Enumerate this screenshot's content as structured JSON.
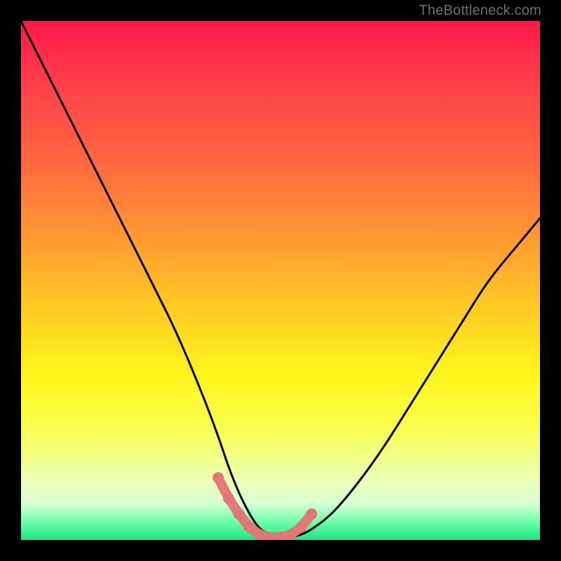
{
  "watermark": "TheBottleneck.com",
  "chart_data": {
    "type": "line",
    "title": "",
    "xlabel": "",
    "ylabel": "",
    "xlim": [
      0,
      100
    ],
    "ylim": [
      0,
      100
    ],
    "grid": false,
    "legend": false,
    "series": [
      {
        "name": "black-curve",
        "color": "#000000",
        "x": [
          0,
          5,
          10,
          15,
          20,
          25,
          30,
          35,
          38,
          40,
          42,
          44,
          46,
          48,
          50,
          52,
          54,
          56,
          60,
          65,
          70,
          75,
          80,
          85,
          90,
          95,
          100
        ],
        "y": [
          100,
          90,
          80,
          70,
          60,
          50,
          40,
          28,
          20,
          14,
          9,
          5,
          2,
          1,
          0.5,
          0.5,
          1,
          2,
          5,
          11,
          18,
          26,
          34,
          42,
          50,
          56,
          62
        ]
      },
      {
        "name": "pink-dots",
        "color": "#e57575",
        "x": [
          38,
          40,
          42,
          44,
          46,
          48,
          50,
          52,
          54,
          56
        ],
        "y": [
          12,
          8,
          5,
          2.5,
          1,
          0.5,
          0.5,
          1,
          2.5,
          5
        ]
      }
    ],
    "background_gradient": {
      "top": "#ff1a4b",
      "mid": "#fff51a",
      "bottom": "#17e884"
    }
  }
}
